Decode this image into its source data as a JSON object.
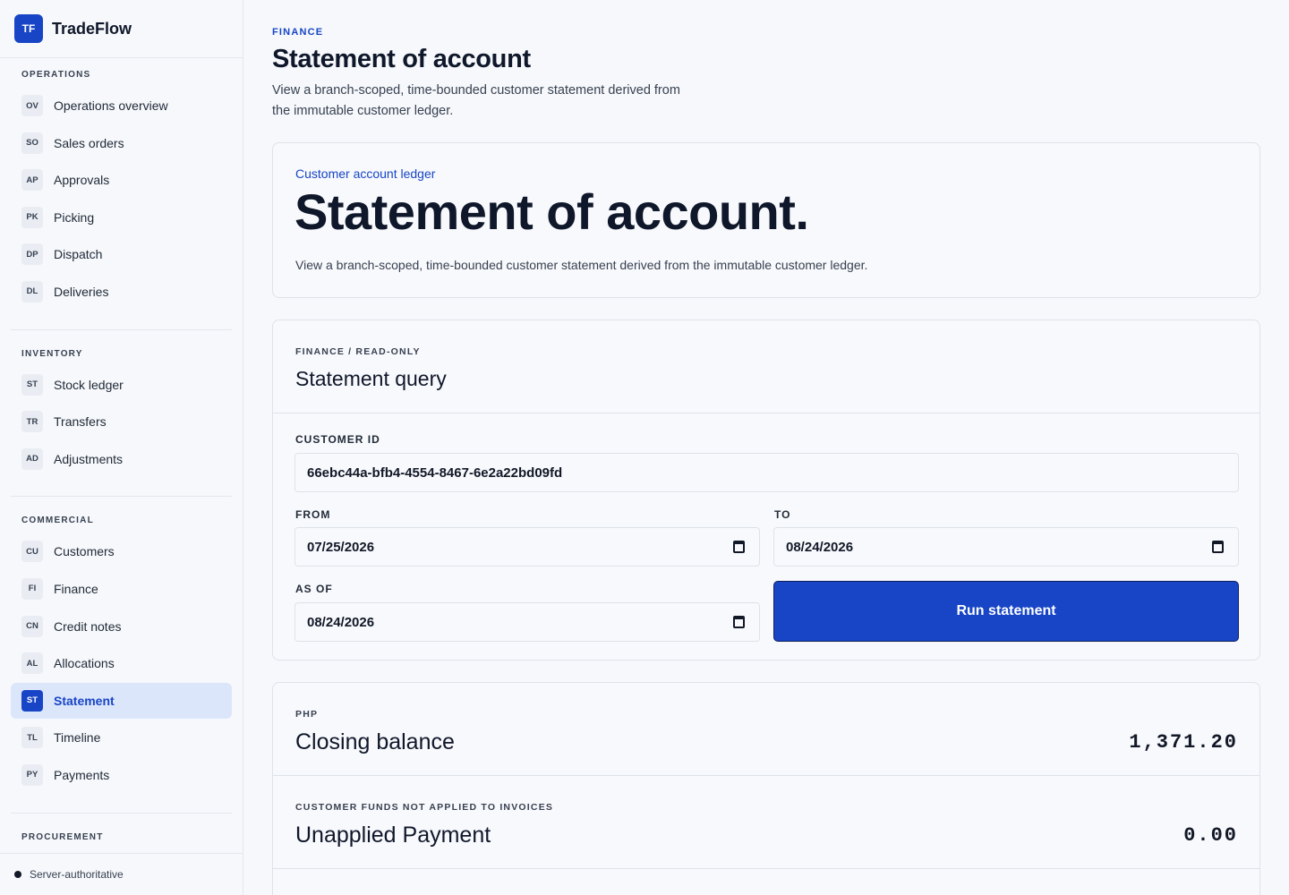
{
  "brand": {
    "logo": "TF",
    "name": "TradeFlow"
  },
  "sidebar": {
    "sections": [
      {
        "heading": "OPERATIONS",
        "items": [
          {
            "code": "OV",
            "label": "Operations overview"
          },
          {
            "code": "SO",
            "label": "Sales orders"
          },
          {
            "code": "AP",
            "label": "Approvals"
          },
          {
            "code": "PK",
            "label": "Picking"
          },
          {
            "code": "DP",
            "label": "Dispatch"
          },
          {
            "code": "DL",
            "label": "Deliveries"
          }
        ]
      },
      {
        "heading": "INVENTORY",
        "items": [
          {
            "code": "ST",
            "label": "Stock ledger"
          },
          {
            "code": "TR",
            "label": "Transfers"
          },
          {
            "code": "AD",
            "label": "Adjustments"
          }
        ]
      },
      {
        "heading": "COMMERCIAL",
        "items": [
          {
            "code": "CU",
            "label": "Customers"
          },
          {
            "code": "FI",
            "label": "Finance"
          },
          {
            "code": "CN",
            "label": "Credit notes"
          },
          {
            "code": "AL",
            "label": "Allocations"
          },
          {
            "code": "ST",
            "label": "Statement",
            "active": true
          },
          {
            "code": "TL",
            "label": "Timeline"
          },
          {
            "code": "PY",
            "label": "Payments"
          }
        ]
      },
      {
        "heading": "PROCUREMENT",
        "items": []
      }
    ],
    "footer": "Server-authoritative"
  },
  "header": {
    "eyebrow": "FINANCE",
    "title": "Statement of account",
    "description": "View a branch-scoped, time-bounded customer statement derived from the immutable customer ledger."
  },
  "hero": {
    "kicker": "Customer account ledger",
    "title": "Statement of account.",
    "description": "View a branch-scoped, time-bounded customer statement derived from the immutable customer ledger."
  },
  "query": {
    "eyebrow": "FINANCE / READ-ONLY",
    "title": "Statement query",
    "customer_id_label": "CUSTOMER ID",
    "customer_id_value": "66ebc44a-bfb4-4554-8467-6e2a22bd09fd",
    "from_label": "FROM",
    "from_value": "07/25/2026",
    "to_label": "TO",
    "to_value": "08/24/2026",
    "as_of_label": "AS OF",
    "as_of_value": "08/24/2026",
    "run_button": "Run statement"
  },
  "balances": [
    {
      "eyebrow": "PHP",
      "title": "Closing balance",
      "value": "1,371.20"
    },
    {
      "eyebrow": "CUSTOMER FUNDS NOT APPLIED TO INVOICES",
      "title": "Unapplied Payment",
      "value": "0.00"
    }
  ],
  "colors": {
    "accent": "#1745c6",
    "active_bg": "#dce6fb",
    "background": "#f6f8fb"
  }
}
